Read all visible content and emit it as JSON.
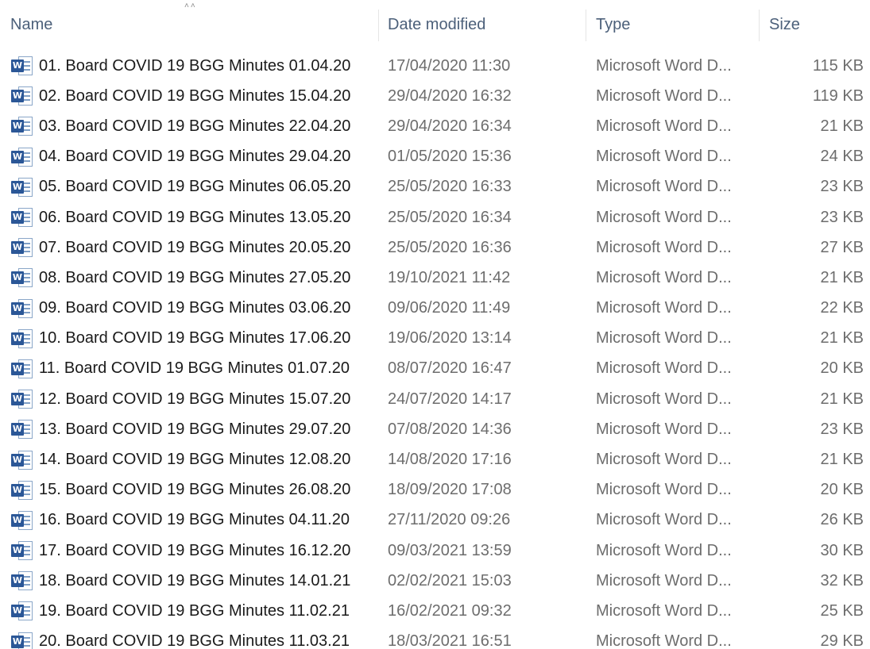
{
  "columns": {
    "name": "Name",
    "date": "Date modified",
    "type": "Type",
    "size": "Size"
  },
  "colors": {
    "header_text": "#4c607a",
    "secondary_text": "#6d6d6d",
    "word_icon": "#2b5797"
  },
  "file_icon": "word-document-icon",
  "files": [
    {
      "name": "01. Board COVID 19 BGG Minutes 01.04.20",
      "date": "17/04/2020 11:30",
      "type": "Microsoft Word D...",
      "size": "115 KB"
    },
    {
      "name": "02. Board COVID 19 BGG Minutes 15.04.20",
      "date": "29/04/2020 16:32",
      "type": "Microsoft Word D...",
      "size": "119 KB"
    },
    {
      "name": "03. Board COVID 19 BGG Minutes 22.04.20",
      "date": "29/04/2020 16:34",
      "type": "Microsoft Word D...",
      "size": "21 KB"
    },
    {
      "name": "04. Board COVID 19 BGG Minutes 29.04.20",
      "date": "01/05/2020 15:36",
      "type": "Microsoft Word D...",
      "size": "24 KB"
    },
    {
      "name": "05. Board COVID 19 BGG Minutes 06.05.20",
      "date": "25/05/2020 16:33",
      "type": "Microsoft Word D...",
      "size": "23 KB"
    },
    {
      "name": "06. Board COVID 19 BGG Minutes 13.05.20",
      "date": "25/05/2020 16:34",
      "type": "Microsoft Word D...",
      "size": "23 KB"
    },
    {
      "name": "07. Board COVID 19 BGG Minutes 20.05.20",
      "date": "25/05/2020 16:36",
      "type": "Microsoft Word D...",
      "size": "27 KB"
    },
    {
      "name": "08. Board COVID 19 BGG Minutes 27.05.20",
      "date": "19/10/2021 11:42",
      "type": "Microsoft Word D...",
      "size": "21 KB"
    },
    {
      "name": "09. Board COVID 19 BGG Minutes 03.06.20",
      "date": "09/06/2020 11:49",
      "type": "Microsoft Word D...",
      "size": "22 KB"
    },
    {
      "name": "10. Board COVID 19 BGG Minutes 17.06.20",
      "date": "19/06/2020 13:14",
      "type": "Microsoft Word D...",
      "size": "21 KB"
    },
    {
      "name": "11. Board COVID 19 BGG Minutes 01.07.20",
      "date": "08/07/2020 16:47",
      "type": "Microsoft Word D...",
      "size": "20 KB"
    },
    {
      "name": "12. Board COVID 19 BGG Minutes 15.07.20",
      "date": "24/07/2020 14:17",
      "type": "Microsoft Word D...",
      "size": "21 KB"
    },
    {
      "name": "13. Board COVID 19 BGG Minutes 29.07.20",
      "date": "07/08/2020 14:36",
      "type": "Microsoft Word D...",
      "size": "23 KB"
    },
    {
      "name": "14. Board COVID 19 BGG Minutes 12.08.20",
      "date": "14/08/2020 17:16",
      "type": "Microsoft Word D...",
      "size": "21 KB"
    },
    {
      "name": "15. Board COVID 19 BGG Minutes 26.08.20",
      "date": "18/09/2020 17:08",
      "type": "Microsoft Word D...",
      "size": "20 KB"
    },
    {
      "name": "16. Board COVID 19 BGG Minutes 04.11.20",
      "date": "27/11/2020 09:26",
      "type": "Microsoft Word D...",
      "size": "26 KB"
    },
    {
      "name": "17. Board COVID 19 BGG Minutes 16.12.20",
      "date": "09/03/2021 13:59",
      "type": "Microsoft Word D...",
      "size": "30 KB"
    },
    {
      "name": "18. Board COVID 19 BGG Minutes 14.01.21",
      "date": "02/02/2021 15:03",
      "type": "Microsoft Word D...",
      "size": "32 KB"
    },
    {
      "name": "19. Board COVID 19 BGG Minutes 11.02.21",
      "date": "16/02/2021 09:32",
      "type": "Microsoft Word D...",
      "size": "25 KB"
    },
    {
      "name": "20. Board COVID 19 BGG Minutes 11.03.21",
      "date": "18/03/2021 16:51",
      "type": "Microsoft Word D...",
      "size": "29 KB"
    }
  ]
}
